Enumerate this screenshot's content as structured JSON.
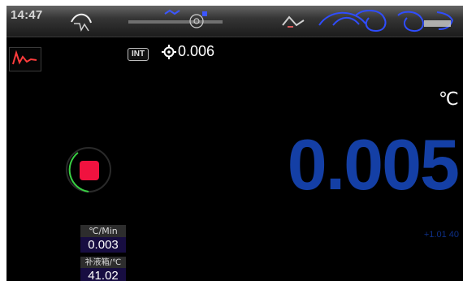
{
  "status_bar": {
    "time": "14:47",
    "icons": [
      "status-symbol-icon",
      "network-icon",
      "usb-icon",
      "settings-icon",
      "alert-icon"
    ]
  },
  "header": {
    "chart_icon": "chart-icon",
    "mode_badge": "INT",
    "target_icon": "crosshair-icon",
    "setpoint": "0.006"
  },
  "main": {
    "unit": "℃",
    "temperature": "0.005",
    "trend": "+1.01 40"
  },
  "controls": {
    "stop_icon": "stop-icon"
  },
  "info_panels": {
    "rate": {
      "label": "℃/Min",
      "value": "0.003"
    },
    "tank": {
      "label": "补液箱/℃",
      "value": "41.02"
    }
  },
  "colors": {
    "screen_bg": "#000000",
    "temperature": "#143fa5",
    "stop": "#f0123f",
    "ring": "#39d043",
    "panel_bg": "#2d2d2d",
    "panel_value_bg": "#170d41"
  }
}
